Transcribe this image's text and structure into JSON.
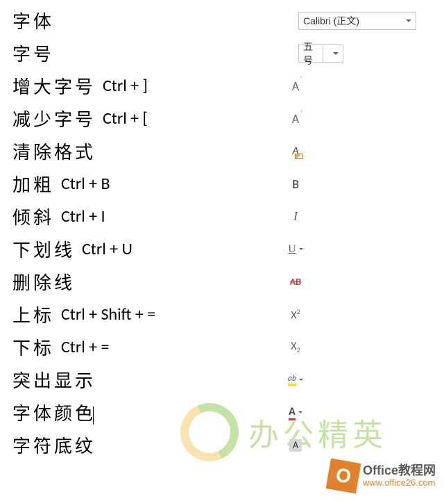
{
  "rows": {
    "font": {
      "label": "字体",
      "value": "Calibri (正文)"
    },
    "size": {
      "label": "字号",
      "value": "五号"
    },
    "grow": {
      "label": "增大字号",
      "shortcut": "Ctrl + ]"
    },
    "shrink": {
      "label": "减少字号",
      "shortcut": "Ctrl + ["
    },
    "clear": {
      "label": "清除格式"
    },
    "bold": {
      "label": "加粗",
      "shortcut": "Ctrl + B"
    },
    "italic": {
      "label": "倾斜",
      "shortcut": "Ctrl + I"
    },
    "underline": {
      "label": "下划线",
      "shortcut": "Ctrl + U"
    },
    "strike": {
      "label": "删除线"
    },
    "super": {
      "label": "上标",
      "shortcut": "Ctrl + Shift + ="
    },
    "sub": {
      "label": "下标",
      "shortcut": "Ctrl + ="
    },
    "highlight": {
      "label": "突出显示"
    },
    "fontcolor": {
      "label": "字体颜色"
    },
    "shading": {
      "label": "字符底纹"
    }
  },
  "watermark": {
    "text": "办公精英"
  },
  "badge": {
    "title": "Office教程网",
    "url": "www.office26.com",
    "letter": "O"
  }
}
